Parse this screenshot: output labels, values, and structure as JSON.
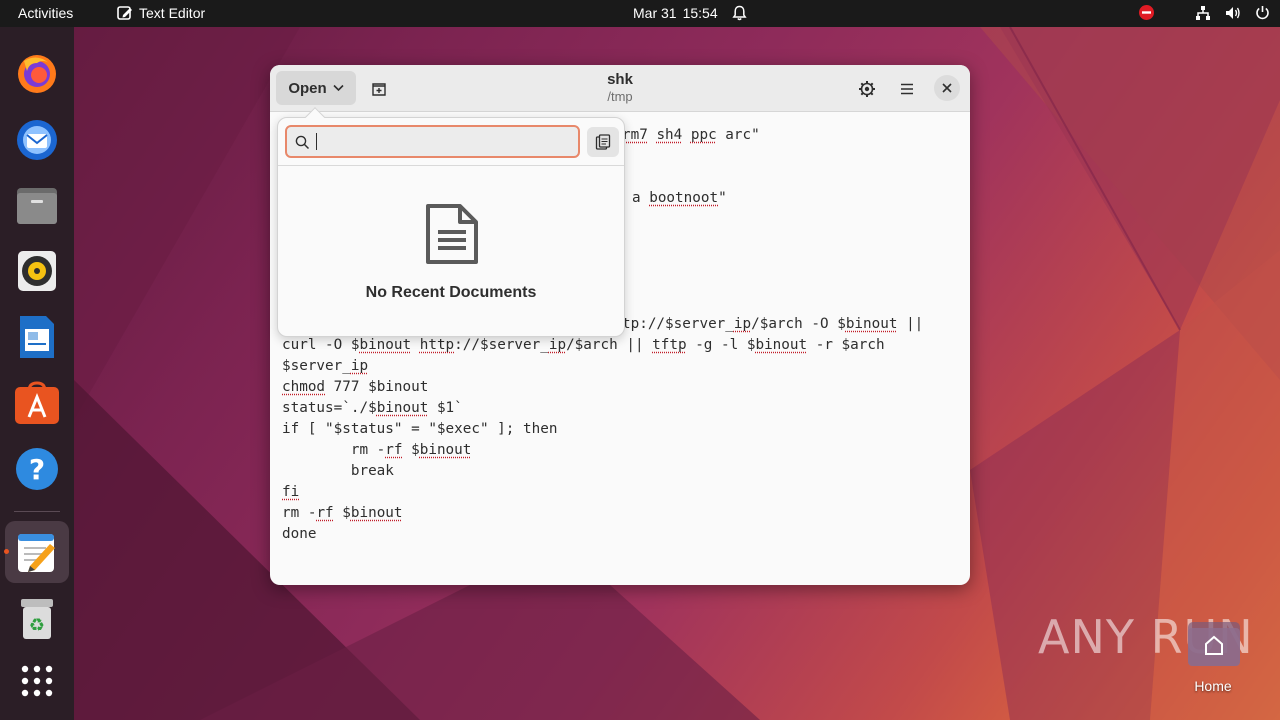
{
  "topbar": {
    "activities": "Activities",
    "app_name": "Text Editor",
    "date": "Mar 31",
    "time": "15:54"
  },
  "dock": {
    "items": [
      "firefox-icon",
      "thunderbird-icon",
      "files-icon",
      "rhythmbox-icon",
      "writer-icon",
      "app-center-icon",
      "help-icon",
      "text-editor-icon",
      "trash-icon",
      "app-grid-icon"
    ]
  },
  "window": {
    "open_label": "Open",
    "title": "shk",
    "subtitle": "/tmp"
  },
  "editor": {
    "lines": [
      {
        "row": 0,
        "col": "partial1",
        "text": ""
      },
      {
        "text_a": "",
        "text_b": ""
      }
    ]
  },
  "popover": {
    "search_placeholder": "",
    "empty_text": "No Recent Documents"
  },
  "desktop": {
    "home_label": "Home",
    "watermark": "ANY RUN"
  }
}
